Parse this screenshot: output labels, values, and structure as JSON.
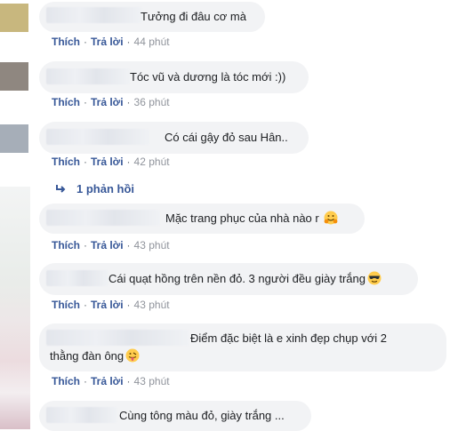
{
  "labels": {
    "like": "Thích",
    "reply": "Trả lời"
  },
  "comments": [
    {
      "text": "Tưởng đi đâu cơ mà",
      "time": "44 phút"
    },
    {
      "text": "Tóc vũ và dương là tóc mới :))",
      "time": "36 phút"
    },
    {
      "text": "Có cái gậy đỏ sau Hân..",
      "time": "42 phút"
    },
    {
      "text": "Mặc trang phục của nhà nào r",
      "time": "43 phút",
      "emoji": "hugging-face-emoji"
    },
    {
      "text": "Cái quạt hồng trên nền đỏ. 3 người đều giày trắng",
      "time": "43 phút",
      "emoji": "sunglasses-face-emoji"
    },
    {
      "text_line1": "Điểm đặc biệt là e xinh đẹp chụp với 2",
      "text_line2": "thằng đàn ông",
      "time": "43 phút",
      "emoji": "tongue-face-emoji"
    },
    {
      "text": "Cùng tông màu đỏ, giày trắng ..."
    }
  ],
  "reply_link": "1 phản hồi",
  "colors": {
    "link": "#385898",
    "bubble": "#f2f3f5",
    "meta": "#90949c"
  }
}
